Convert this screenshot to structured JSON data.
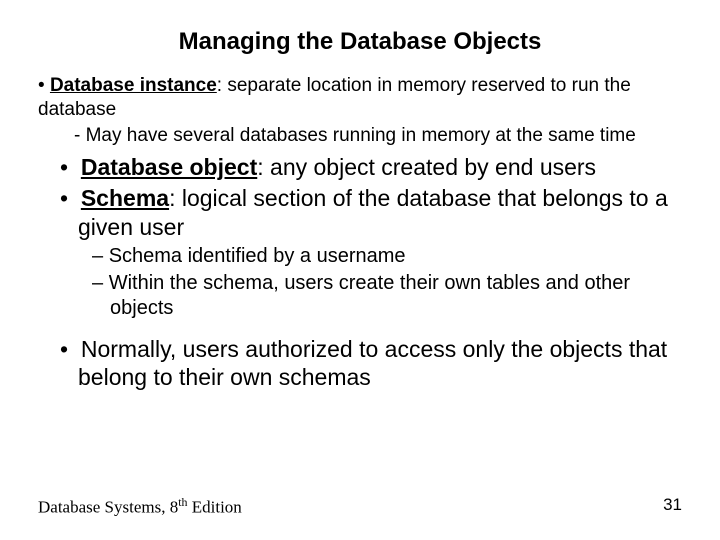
{
  "title": "Managing the Database Objects",
  "b1_lead": "Database instance",
  "b1_rest": ": separate location in memory reserved to run the database",
  "b1_sub": "- May have several databases running in memory at the same time",
  "b2_lead": "Database object",
  "b2_rest": ": any object created by end users",
  "b3_lead": "Schema",
  "b3_rest": ": logical section of the database that belongs to a given user",
  "b3_sub1": "Schema identified by a username",
  "b3_sub2": "Within the schema, users create their own tables and other objects",
  "b4": "Normally, users authorized to access only the objects that belong to their own schemas",
  "footer_book_pre": "Database Systems, 8",
  "footer_book_sup": "th",
  "footer_book_post": " Edition",
  "page_number": "31"
}
